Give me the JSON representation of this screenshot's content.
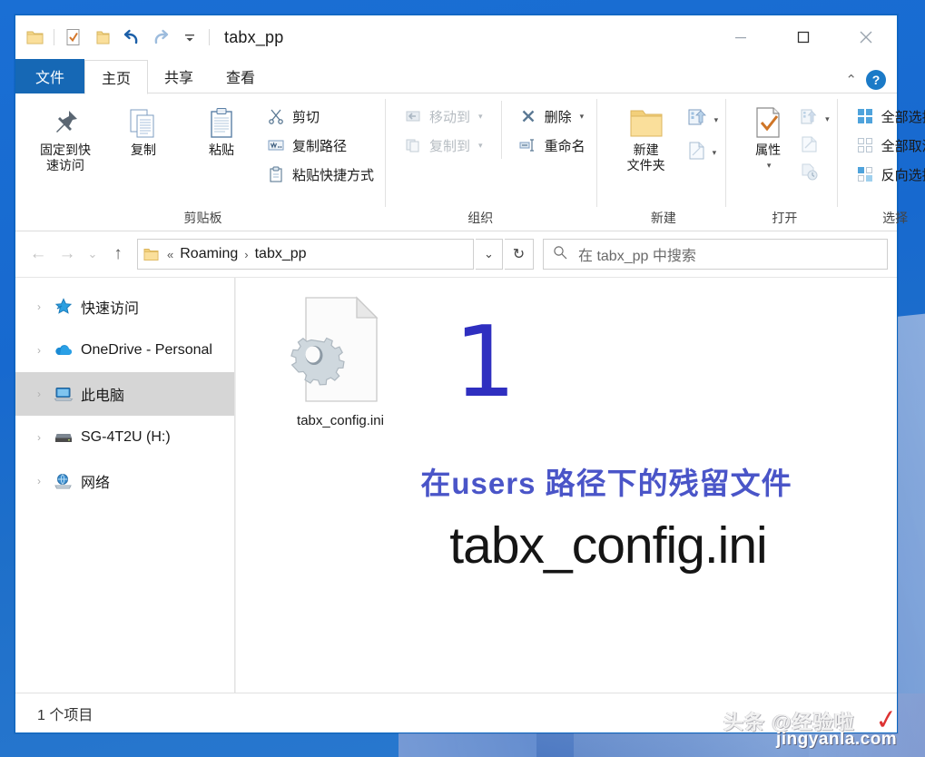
{
  "window": {
    "title": "tabx_pp",
    "quick_access": [
      {
        "name": "folder-icon",
        "label": "文件资源管理器"
      },
      {
        "name": "properties-icon",
        "label": "属性"
      },
      {
        "name": "new-folder-icon",
        "label": "新建文件夹"
      },
      {
        "name": "undo-icon",
        "label": "撤消"
      },
      {
        "name": "redo-icon",
        "label": "恢复"
      },
      {
        "name": "customize-qat-icon",
        "label": "自定义快速访问工具栏"
      }
    ],
    "controls": {
      "minimize": "—",
      "maximize": "▢",
      "close": "✕"
    }
  },
  "tabs": [
    {
      "label": "文件",
      "type": "file"
    },
    {
      "label": "主页",
      "type": "active"
    },
    {
      "label": "共享",
      "type": "normal"
    },
    {
      "label": "查看",
      "type": "normal"
    }
  ],
  "ribbon": {
    "collapse_label": "⌃",
    "help_label": "?",
    "groups": [
      {
        "title": "剪贴板",
        "big_buttons": [
          {
            "label": "固定到快\n速访问",
            "icon": "pin-icon"
          },
          {
            "label": "复制",
            "icon": "copy-icon"
          },
          {
            "label": "粘贴",
            "icon": "paste-icon"
          }
        ],
        "small_buttons": [
          {
            "label": "剪切",
            "icon": "scissors-icon",
            "disabled": false
          },
          {
            "label": "复制路径",
            "icon": "copy-path-icon",
            "disabled": false
          },
          {
            "label": "粘贴快捷方式",
            "icon": "paste-shortcut-icon",
            "disabled": false
          }
        ]
      },
      {
        "title": "组织",
        "small_buttons": [
          {
            "label": "移动到",
            "icon": "move-to-icon",
            "disabled": true,
            "caret": true
          },
          {
            "label": "复制到",
            "icon": "copy-to-icon",
            "disabled": true,
            "caret": true
          }
        ],
        "small_buttons2": [
          {
            "label": "删除",
            "icon": "delete-icon",
            "disabled": false,
            "caret": true
          },
          {
            "label": "重命名",
            "icon": "rename-icon",
            "disabled": false,
            "caret": false
          }
        ]
      },
      {
        "title": "新建",
        "big_buttons": [
          {
            "label": "新建\n文件夹",
            "icon": "new-folder-big-icon"
          }
        ],
        "icon_column": [
          {
            "name": "new-item-icon",
            "caret": true
          },
          {
            "name": "easy-access-icon",
            "caret": true
          }
        ]
      },
      {
        "title": "打开",
        "big_buttons": [
          {
            "label": "属性",
            "icon": "properties-big-icon",
            "caret": true
          }
        ],
        "icon_column": [
          {
            "name": "open-with-icon",
            "caret": true
          },
          {
            "name": "edit-icon",
            "caret": false
          },
          {
            "name": "history-icon",
            "caret": false
          }
        ]
      },
      {
        "title": "选择",
        "small_buttons": [
          {
            "label": "全部选择",
            "icon": "select-all-icon",
            "disabled": false
          },
          {
            "label": "全部取消",
            "icon": "select-none-icon",
            "disabled": false
          },
          {
            "label": "反向选择",
            "icon": "invert-selection-icon",
            "disabled": false
          }
        ]
      }
    ]
  },
  "addressbar": {
    "back": "←",
    "forward": "→",
    "recent": "⌄",
    "up": "↑",
    "breadcrumb_prefix": "«",
    "breadcrumbs": [
      "Roaming",
      "tabx_pp"
    ],
    "breadcrumb_separator": "›",
    "dropdown": "⌄",
    "refresh": "↻",
    "search_placeholder": "在 tabx_pp 中搜索",
    "search_value": ""
  },
  "navpane": {
    "items": [
      {
        "label": "快速访问",
        "icon": "quick-access-star-icon",
        "selected": false
      },
      {
        "label": "OneDrive - Personal",
        "icon": "onedrive-cloud-icon",
        "selected": false
      },
      {
        "label": "此电脑",
        "icon": "this-pc-icon",
        "selected": true
      },
      {
        "label": "SG-4T2U (H:)",
        "icon": "external-drive-icon",
        "selected": false
      },
      {
        "label": "网络",
        "icon": "network-icon",
        "selected": false
      }
    ]
  },
  "content": {
    "files": [
      {
        "name": "tabx_config.ini",
        "icon": "ini-config-file-icon"
      }
    ],
    "annotations": {
      "step_number": "1",
      "step_number_color": "#2f2fc0",
      "line1": "在users 路径下的残留文件",
      "line1_color": "#4a55c8",
      "line2": "tabx_config.ini",
      "line2_color": "#151515"
    }
  },
  "statusbar": {
    "item_count": "1 个项目"
  },
  "watermark": {
    "line1": "头条 @经验啦",
    "line2": "jingyanla.com",
    "mark": "✓"
  }
}
